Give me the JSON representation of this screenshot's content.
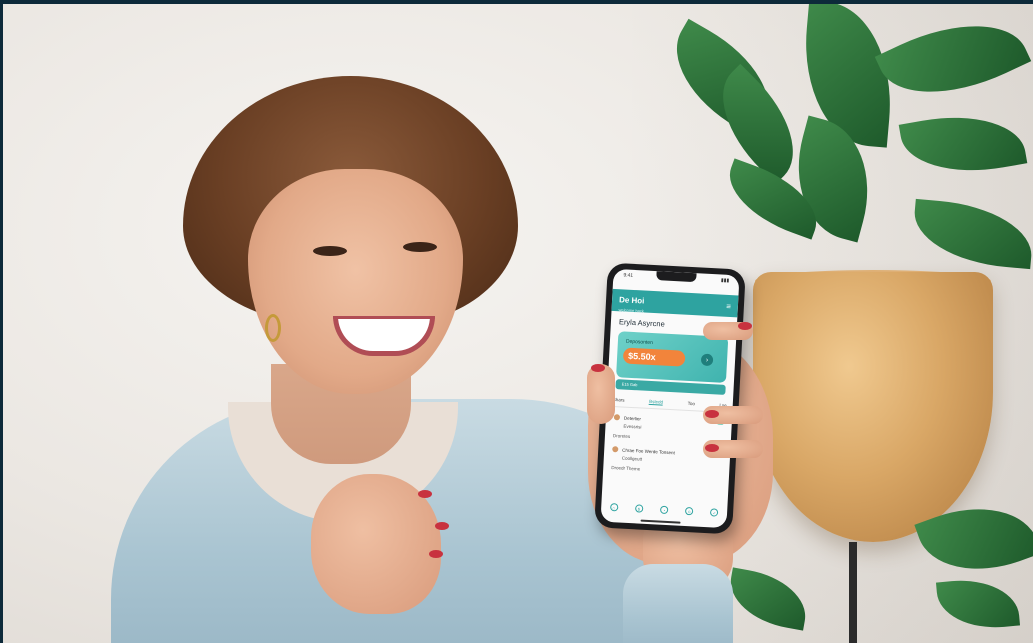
{
  "photo": {
    "phone": {
      "status": {
        "time": "9:41",
        "signal": "▮▮▮"
      },
      "header": {
        "title": "De Hoi",
        "subtitle": "welcome back",
        "menu_icon": "menu-icon"
      },
      "greeting": "Eryla Asyrcne",
      "card": {
        "label": "Deposonten",
        "amount": "$5.50x",
        "go_icon": "arrow-right-icon",
        "footer": "E15 Gab"
      },
      "tabs": [
        "Shars",
        "Bstedd",
        "Too",
        "Lse"
      ],
      "active_tab": 1,
      "rows": [
        {
          "label": "Deterlier",
          "sub": "Evessrisi"
        },
        {
          "label": "Droretes",
          "sub": ""
        },
        {
          "label": "Chrae Foe Werde Tonsent",
          "sub": "Coollgeutt"
        },
        {
          "label": "Droedr Theme",
          "sub": ""
        }
      ],
      "bottom_nav": [
        "home-icon",
        "wallet-icon",
        "chart-icon",
        "user-icon",
        "settings-icon"
      ],
      "bottom_nav_glyphs": [
        "⌂",
        "$",
        "◔",
        "☺",
        "✓"
      ]
    }
  }
}
